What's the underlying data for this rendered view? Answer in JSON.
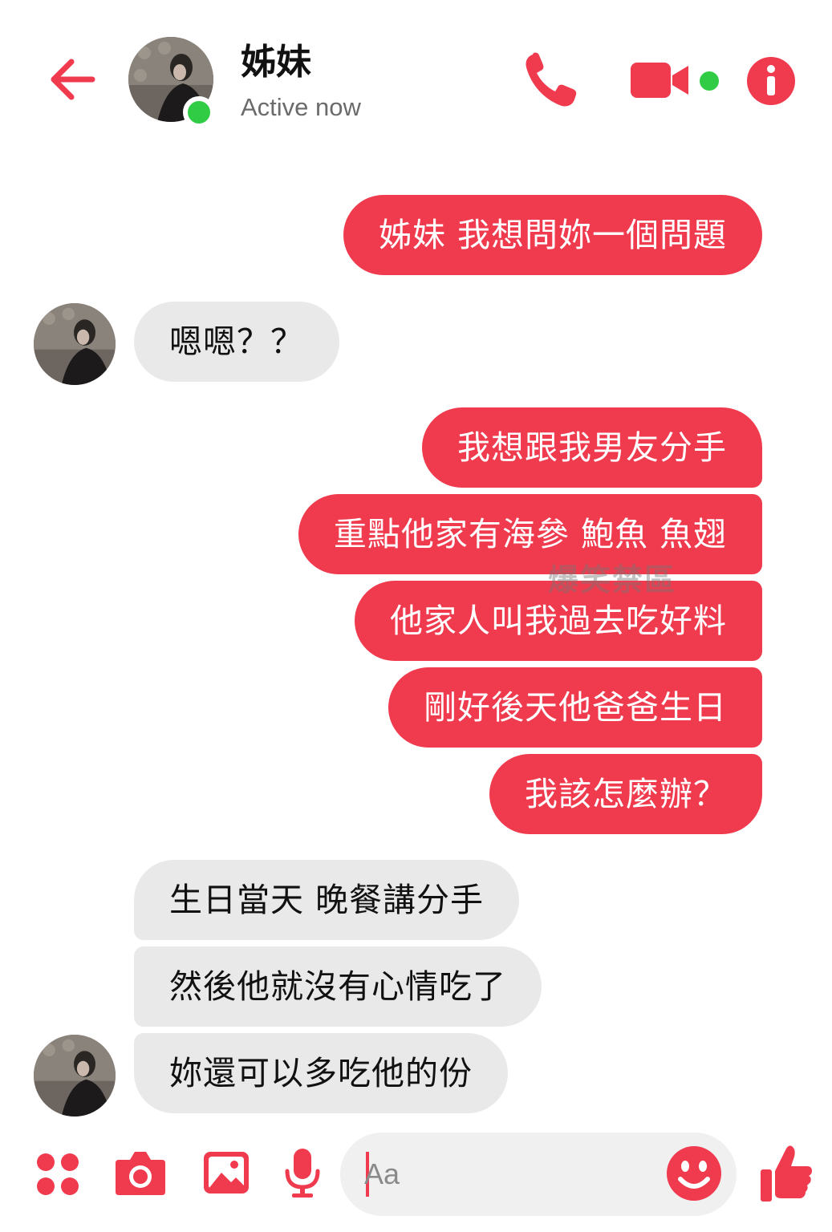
{
  "colors": {
    "accent": "#f03a4e",
    "incoming_bubble": "#e9e9ea",
    "presence": "#31cc46"
  },
  "header": {
    "contact_name": "姊妹",
    "status": "Active now",
    "icons": {
      "back": "back-arrow-icon",
      "phone": "phone-icon",
      "video": "video-camera-icon",
      "info": "info-icon"
    }
  },
  "messages": [
    {
      "direction": "outgoing",
      "text": "姊妹 我想問妳一個問題"
    },
    {
      "direction": "incoming",
      "text": "嗯嗯？？"
    },
    {
      "direction": "outgoing",
      "text": "我想跟我男友分手"
    },
    {
      "direction": "outgoing",
      "text": "重點他家有海參 鮑魚  魚翅"
    },
    {
      "direction": "outgoing",
      "text": "他家人叫我過去吃好料"
    },
    {
      "direction": "outgoing",
      "text": "剛好後天他爸爸生日"
    },
    {
      "direction": "outgoing",
      "text": "我該怎麼辦？"
    },
    {
      "direction": "incoming",
      "text": "生日當天 晚餐講分手"
    },
    {
      "direction": "incoming",
      "text": "然後他就沒有心情吃了"
    },
    {
      "direction": "incoming",
      "text": "妳還可以多吃他的份"
    }
  ],
  "watermark": "爆笑禁區",
  "composer": {
    "placeholder": "Aa",
    "icons": [
      "apps-icon",
      "camera-icon",
      "image-icon",
      "microphone-icon",
      "emoji-icon",
      "thumbs-up-icon"
    ]
  }
}
